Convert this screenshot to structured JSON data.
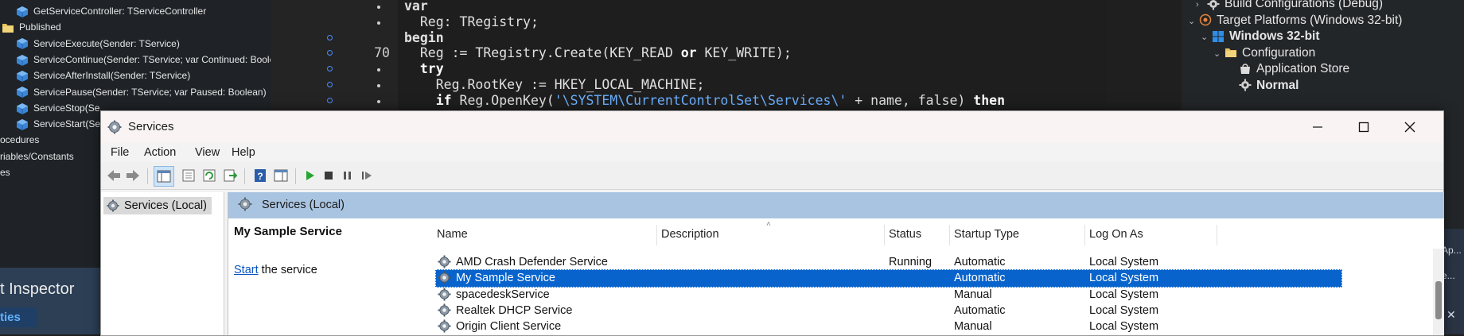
{
  "ide": {
    "structure_tree": [
      {
        "label": "GetServiceController: TServiceController",
        "icon": "method-cube-icon",
        "indent": 1
      },
      {
        "label": "Published",
        "icon": "folder-icon",
        "indent": 0
      },
      {
        "label": "ServiceExecute(Sender: TService)",
        "icon": "method-cube-icon",
        "indent": 1
      },
      {
        "label": "ServiceContinue(Sender: TService; var Continued: Boolean)",
        "icon": "method-cube-icon",
        "indent": 1
      },
      {
        "label": "ServiceAfterInstall(Sender: TService)",
        "icon": "method-cube-icon",
        "indent": 1
      },
      {
        "label": "ServicePause(Sender: TService; var Paused: Boolean)",
        "icon": "method-cube-icon",
        "indent": 1
      },
      {
        "label": "ServiceStop(Se",
        "icon": "method-cube-icon",
        "indent": 1
      },
      {
        "label": "ServiceStart(Se",
        "icon": "method-cube-icon",
        "indent": 1
      },
      {
        "label": "ocedures",
        "icon": "",
        "indent": -1
      },
      {
        "label": "riables/Constants",
        "icon": "",
        "indent": -1
      },
      {
        "label": "es",
        "icon": "",
        "indent": -1
      }
    ],
    "inspector_title": "t Inspector",
    "properties_tab": "ties",
    "code_lines": [
      {
        "gutter": ".",
        "text": "var",
        "kind": "kw"
      },
      {
        "gutter": ".",
        "text": "  Reg: TRegistry;",
        "kind": "plain"
      },
      {
        "gutter": "",
        "text": "begin",
        "kind": "kw"
      },
      {
        "gutter": "70",
        "text": "  Reg := TRegistry.Create(KEY_READ or KEY_WRITE);",
        "kind": "or"
      },
      {
        "gutter": ".",
        "text": "  try",
        "kind": "kw-indent"
      },
      {
        "gutter": ".",
        "text": "    Reg.RootKey := HKEY_LOCAL_MACHINE;",
        "kind": "plain"
      },
      {
        "gutter": ".",
        "text": "    if Reg.OpenKey('\\SYSTEM\\CurrentControlSet\\Services\\' + name, false) then",
        "kind": "plain"
      }
    ],
    "project_tree": [
      {
        "label": "Build Configurations (Debug)",
        "icon": "gear-icon",
        "chevron": ">"
      },
      {
        "label": "Target Platforms (Windows 32-bit)",
        "icon": "target-icon",
        "chevron": "v"
      },
      {
        "label": "Windows 32-bit",
        "icon": "windows-icon",
        "chevron": "v"
      },
      {
        "label": "Configuration",
        "icon": "folder-icon",
        "chevron": "v"
      },
      {
        "label": "Application Store",
        "icon": "store-icon",
        "chevron": ""
      },
      {
        "label": "Normal",
        "icon": "gear-icon",
        "chevron": ""
      }
    ],
    "right_strip_lines": [
      "Ap...",
      "e..."
    ]
  },
  "window": {
    "title": "Services",
    "menu": [
      "File",
      "Action",
      "View",
      "Help"
    ],
    "tree_item": "Services (Local)",
    "pane_header": "Services (Local)",
    "detail": {
      "title": "My Sample Service",
      "start_link": "Start",
      "start_suffix": " the service"
    },
    "columns": [
      "Name",
      "Description",
      "Status",
      "Startup Type",
      "Log On As"
    ],
    "rows": [
      {
        "name": "AMD Crash Defender Service",
        "description": "",
        "status": "Running",
        "startup": "Automatic",
        "logon": "Local System",
        "selected": false
      },
      {
        "name": "My Sample Service",
        "description": "",
        "status": "",
        "startup": "Automatic",
        "logon": "Local System",
        "selected": true
      },
      {
        "name": "spacedeskService",
        "description": "",
        "status": "",
        "startup": "Manual",
        "logon": "Local System",
        "selected": false
      },
      {
        "name": "Realtek DHCP Service",
        "description": "",
        "status": "",
        "startup": "Automatic",
        "logon": "Local System",
        "selected": false
      },
      {
        "name": "Origin Client Service",
        "description": "",
        "status": "",
        "startup": "Manual",
        "logon": "Local System",
        "selected": false
      }
    ]
  },
  "colors": {
    "selection": "#0864cc",
    "pane_header": "#a9c4e0",
    "link": "#0a54c2"
  }
}
